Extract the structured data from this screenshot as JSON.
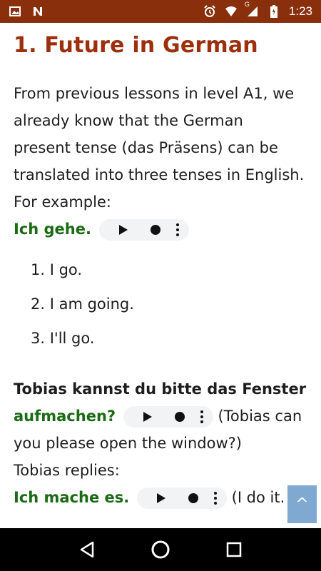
{
  "status_bar": {
    "time": "1:23",
    "icons": [
      "image-icon",
      "n-icon",
      "alarm-icon",
      "wifi-icon",
      "signal-icon",
      "battery-icon"
    ],
    "network_label": "G"
  },
  "article": {
    "title": "1. Future in German",
    "intro_lines": [
      "From previous lessons in level A1, we",
      "already know that the German",
      "present tense (das Präsens) can be",
      "translated into three tenses in English.",
      "For example:"
    ],
    "example1": {
      "german": "Ich gehe.",
      "translations": [
        "I go.",
        "I am going.",
        "I'll go."
      ],
      "numbers": [
        "1.",
        "2.",
        "3."
      ]
    },
    "example2": {
      "german_line1": "Tobias kannst du bitte das Fenster",
      "german_line2": "aufmachen?",
      "translation_part1": "(Tobias can",
      "translation_part2": "you please open the window?)",
      "reply_intro": "Tobias replies:",
      "reply_german": "Ich mache es.",
      "reply_translation": "(I do it. / I"
    }
  },
  "scroll_top": {
    "label": "^"
  },
  "colors": {
    "status_bar": "#8a2f0c",
    "title": "#9c300d",
    "german_text": "#1a6b14",
    "scroll_top": "#7fa9d0"
  }
}
